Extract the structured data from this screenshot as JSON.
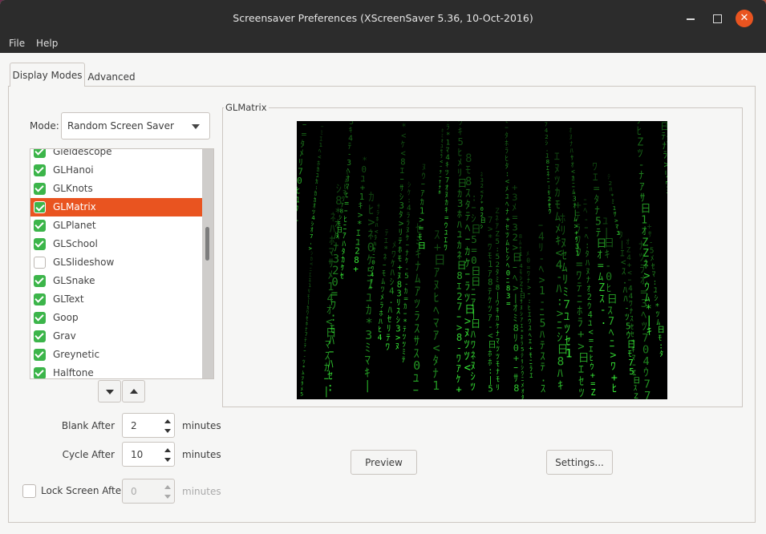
{
  "window": {
    "title": "Screensaver Preferences  (XScreenSaver 5.36, 10-Oct-2016)"
  },
  "menubar": {
    "file": "File",
    "help": "Help"
  },
  "tabs": [
    {
      "label": "Display Modes",
      "active": true
    },
    {
      "label": "Advanced",
      "active": false
    }
  ],
  "mode": {
    "label": "Mode:",
    "value": "Random Screen Saver"
  },
  "list": {
    "items": [
      {
        "label": "Gleidescope",
        "checked": true
      },
      {
        "label": "GLHanoi",
        "checked": true
      },
      {
        "label": "GLKnots",
        "checked": true
      },
      {
        "label": "GLMatrix",
        "checked": true,
        "selected": true
      },
      {
        "label": "GLPlanet",
        "checked": true
      },
      {
        "label": "GLSchool",
        "checked": true
      },
      {
        "label": "GLSlideshow",
        "checked": false
      },
      {
        "label": "GLSnake",
        "checked": true
      },
      {
        "label": "GLText",
        "checked": true
      },
      {
        "label": "Goop",
        "checked": true
      },
      {
        "label": "Grav",
        "checked": true
      },
      {
        "label": "Greynetic",
        "checked": true
      },
      {
        "label": "Halftone",
        "checked": true
      }
    ]
  },
  "timing": {
    "blank_label": "Blank After",
    "blank_value": "2",
    "cycle_label": "Cycle After",
    "cycle_value": "10",
    "lock_label": "Lock Screen After",
    "lock_value": "0",
    "unit": "minutes"
  },
  "preview": {
    "frame_label": "GLMatrix",
    "preview_button": "Preview",
    "settings_button": "Settings..."
  },
  "colors": {
    "accent": "#e95420",
    "check": "#3cb54a",
    "matrix_green": "#3cff3c"
  },
  "icons": [
    "minimize-icon",
    "maximize-icon",
    "close-icon",
    "chevron-down-icon",
    "arrow-down-icon",
    "arrow-up-icon",
    "checkbox-icon"
  ]
}
